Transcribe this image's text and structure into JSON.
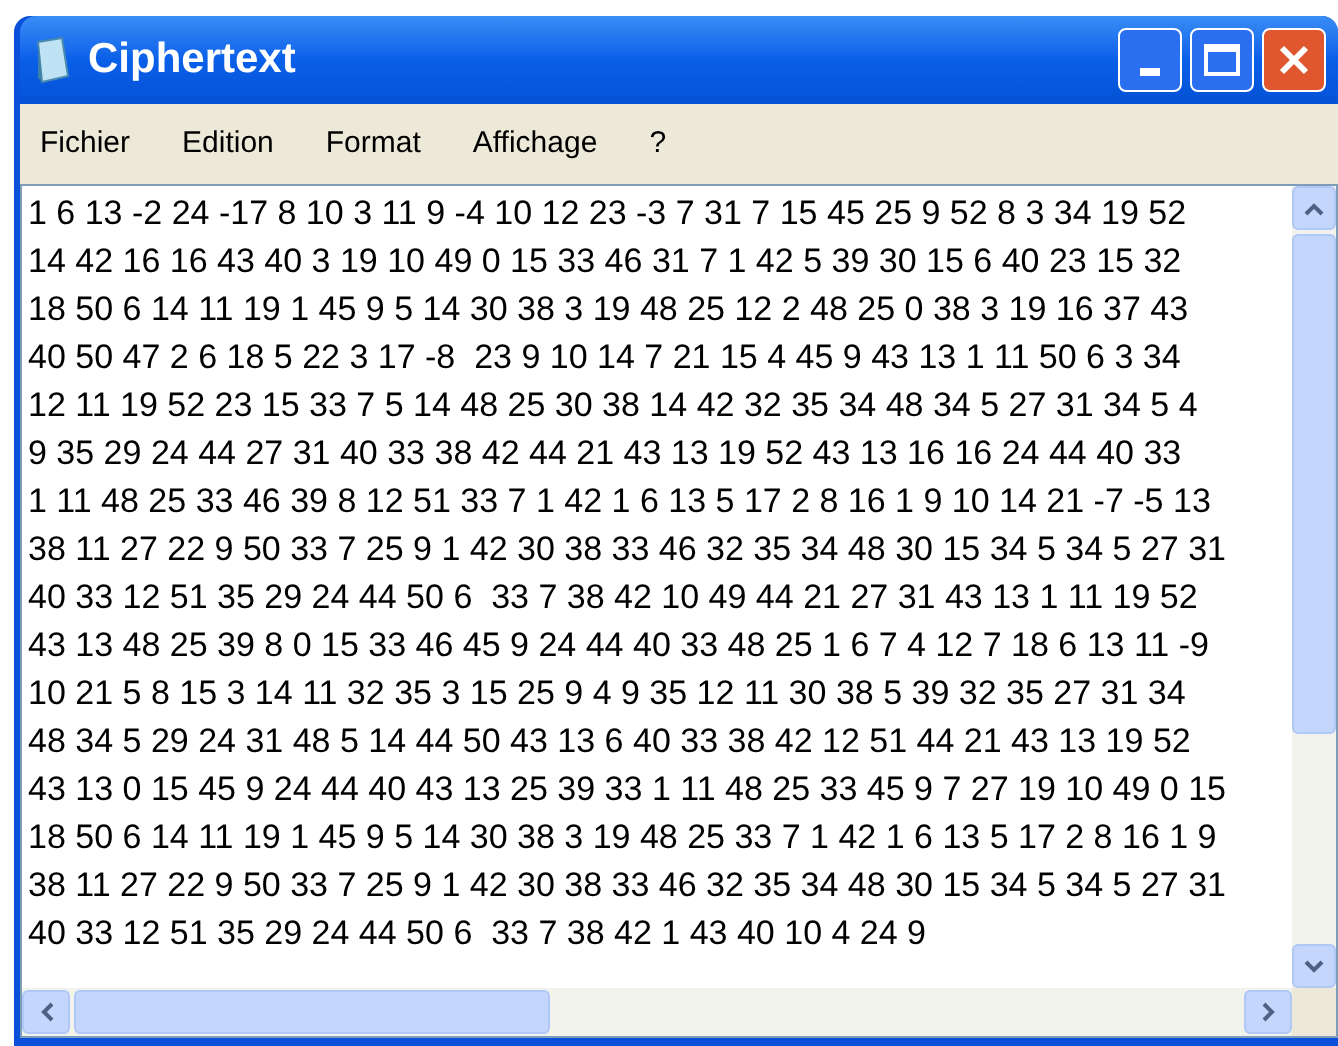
{
  "window": {
    "title": "Ciphertext"
  },
  "menu": [
    "Fichier",
    "Edition",
    "Format",
    "Affichage",
    "?"
  ],
  "lines": [
    "1 6 13 -2 24 -17 8 10 3 11 9 -4 10 12 23 -3 7 31 7 15 45 25 9 52 8 3 34 19 52",
    "14 42 16 16 43 40 3 19 10 49 0 15 33 46 31 7 1 42 5 39 30 15 6 40 23 15 32",
    "18 50 6 14 11 19 1 45 9 5 14 30 38 3 19 48 25 12 2 48 25 0 38 3 19 16 37 43",
    "40 50 47 2 6 18 5 22 3 17 -8  23 9 10 14 7 21 15 4 45 9 43 13 1 11 50 6 3 34",
    "12 11 19 52 23 15 33 7 5 14 48 25 30 38 14 42 32 35 34 48 34 5 27 31 34 5 4",
    "9 35 29 24 44 27 31 40 33 38 42 44 21 43 13 19 52 43 13 16 16 24 44 40 33",
    "1 11 48 25 33 46 39 8 12 51 33 7 1 42 1 6 13 5 17 2 8 16 1 9 10 14 21 -7 -5 13",
    "38 11 27 22 9 50 33 7 25 9 1 42 30 38 33 46 32 35 34 48 30 15 34 5 34 5 27 31",
    "40 33 12 51 35 29 24 44 50 6  33 7 38 42 10 49 44 21 27 31 43 13 1 11 19 52",
    "43 13 48 25 39 8 0 15 33 46 45 9 24 44 40 33 48 25 1 6 7 4 12 7 18 6 13 11 -9",
    "10 21 5 8 15 3 14 11 32 35 3 15 25 9 4 9 35 12 11 30 38 5 39 32 35 27 31 34",
    "48 34 5 29 24 31 48 5 14 44 50 43 13 6 40 33 38 42 12 51 44 21 43 13 19 52",
    "43 13 0 15 45 9 24 44 40 43 13 25 39 33 1 11 48 25 33 45 9 7 27 19 10 49 0 15",
    "18 50 6 14 11 19 1 45 9 5 14 30 38 3 19 48 25 33 7 1 42 1 6 13 5 17 2 8 16 1 9",
    "38 11 27 22 9 50 33 7 25 9 1 42 30 38 33 46 32 35 34 48 30 15 34 5 34 5 27 31",
    "40 33 12 51 35 29 24 44 50 6  33 7 38 42 1 43 40 10 4 24 9"
  ]
}
